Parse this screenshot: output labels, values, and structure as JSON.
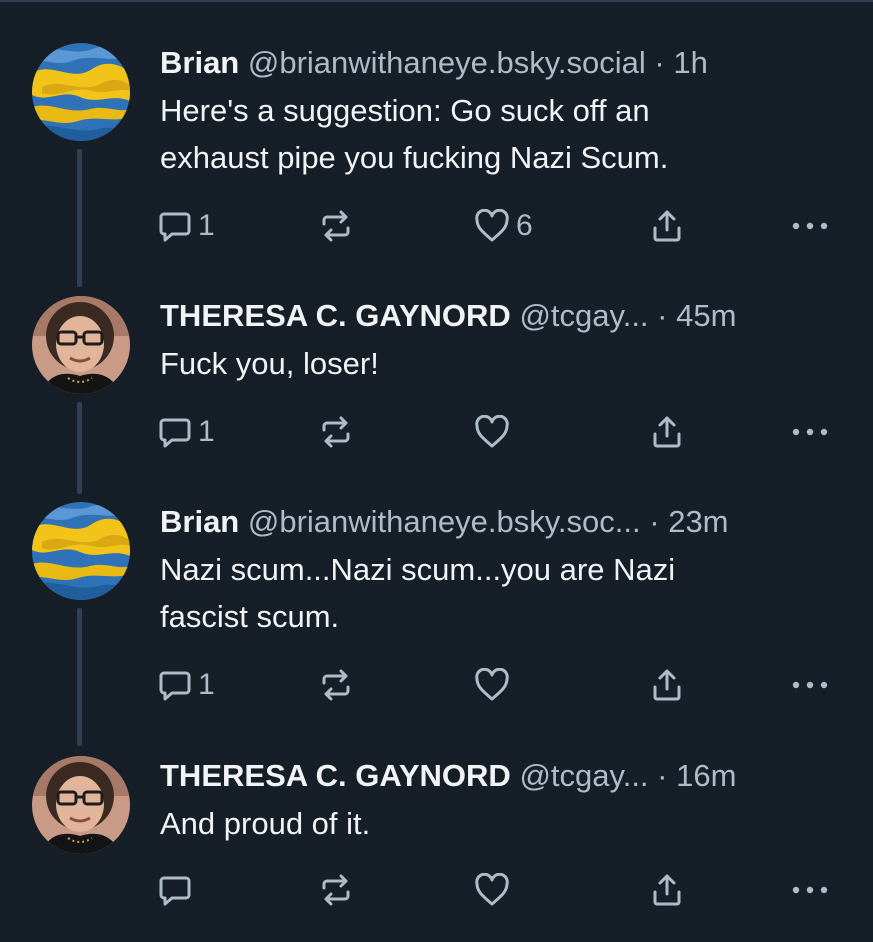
{
  "posts": [
    {
      "author": "Brian",
      "handle": "@brianwithaneye.bsky.social",
      "separator": "·",
      "time": "1h",
      "text": [
        "Here's a suggestion: Go suck off an",
        "exhaust pipe you fucking Nazi Scum."
      ],
      "reply_count": "1",
      "like_count": "6",
      "avatar": "ukraine-flag-avatar"
    },
    {
      "author": "THERESA C. GAYNORD",
      "handle": "@tcgay...",
      "separator": "·",
      "time": "45m",
      "text": [
        "Fuck you, loser!"
      ],
      "reply_count": "1",
      "like_count": "",
      "avatar": "woman-glasses-avatar"
    },
    {
      "author": "Brian",
      "handle": "@brianwithaneye.bsky.soc...",
      "separator": "·",
      "time": "23m",
      "text": [
        "Nazi scum...Nazi scum...you are Nazi",
        "fascist scum."
      ],
      "reply_count": "1",
      "like_count": "",
      "avatar": "ukraine-flag-avatar"
    },
    {
      "author": "THERESA C. GAYNORD",
      "handle": "@tcgay...",
      "separator": "·",
      "time": "16m",
      "text": [
        "And proud of it."
      ],
      "reply_count": "",
      "like_count": "",
      "avatar": "woman-glasses-avatar"
    }
  ],
  "colors": {
    "background": "#161e27",
    "text": "#f1f3f5",
    "muted": "#aebbc9",
    "thread_line": "#2e4052"
  }
}
